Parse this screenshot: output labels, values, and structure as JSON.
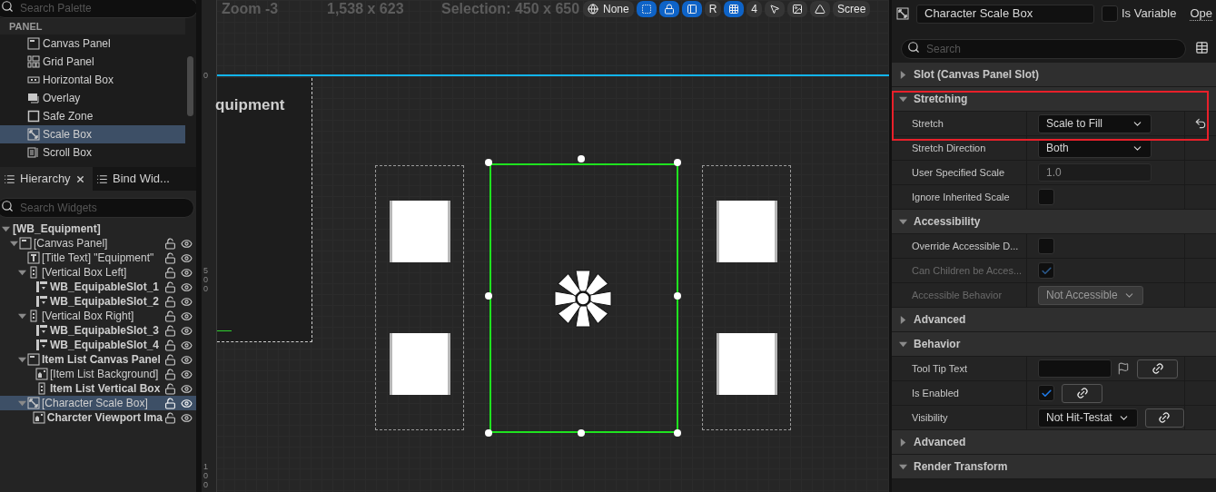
{
  "palette": {
    "search_placeholder": "Search Palette",
    "category": "PANEL",
    "items": [
      {
        "label": "Canvas Panel",
        "kind": "canvas",
        "selected": false
      },
      {
        "label": "Grid Panel",
        "kind": "grid",
        "selected": false
      },
      {
        "label": "Horizontal Box",
        "kind": "hbox",
        "selected": false
      },
      {
        "label": "Overlay",
        "kind": "overlay",
        "selected": false
      },
      {
        "label": "Safe Zone",
        "kind": "safezone",
        "selected": false
      },
      {
        "label": "Scale Box",
        "kind": "scalebox",
        "selected": true
      },
      {
        "label": "Scroll Box",
        "kind": "scrollbox",
        "selected": false
      }
    ]
  },
  "hierarchy": {
    "tabs": [
      {
        "label": "Hierarchy",
        "selected": true,
        "closable": true
      },
      {
        "label": "Bind Wid...",
        "selected": false,
        "closable": false
      }
    ],
    "search_placeholder": "Search Widgets",
    "tree": [
      {
        "label": "[WB_Equipment]",
        "kind": "root",
        "bold": true,
        "selected": false,
        "expanded": true,
        "children": [
          {
            "label": "[Canvas Panel]",
            "kind": "canvas",
            "bold": false,
            "selected": false,
            "expanded": true,
            "children": [
              {
                "label": "[Title Text] \"Equipment\"",
                "kind": "text",
                "bold": false,
                "selected": false
              },
              {
                "label": "[Vertical Box Left]",
                "kind": "vbox",
                "bold": false,
                "selected": false,
                "expanded": true,
                "children": [
                  {
                    "label": "WB_EquipableSlot_1",
                    "kind": "userwidget",
                    "bold": true,
                    "selected": false
                  },
                  {
                    "label": "WB_EquipableSlot_2",
                    "kind": "userwidget",
                    "bold": true,
                    "selected": false
                  }
                ]
              },
              {
                "label": "[Vertical Box Right]",
                "kind": "vbox",
                "bold": false,
                "selected": false,
                "expanded": true,
                "children": [
                  {
                    "label": "WB_EquipableSlot_3",
                    "kind": "userwidget",
                    "bold": true,
                    "selected": false
                  },
                  {
                    "label": "WB_EquipableSlot_4",
                    "kind": "userwidget",
                    "bold": true,
                    "selected": false
                  }
                ]
              },
              {
                "label": "Item List Canvas Panel",
                "kind": "canvas",
                "bold": true,
                "selected": false,
                "expanded": true,
                "children": [
                  {
                    "label": "[Item List Background]",
                    "kind": "image",
                    "bold": false,
                    "selected": false
                  },
                  {
                    "label": "Item List Vertical Box",
                    "kind": "vbox",
                    "bold": true,
                    "selected": false
                  }
                ]
              },
              {
                "label": "[Character Scale Box]",
                "kind": "scalebox",
                "bold": false,
                "selected": true,
                "expanded": true,
                "children": [
                  {
                    "label": "Charcter Viewport Ima",
                    "kind": "image",
                    "bold": true,
                    "selected": false
                  }
                ]
              }
            ]
          }
        ]
      }
    ]
  },
  "canvas": {
    "toolbar": {
      "zoom": "Zoom -3",
      "resolution": "1,538 x 623",
      "selection": "Selection: 450 x 650",
      "buttons": [
        {
          "kind": "globe",
          "label": "None",
          "on": false
        },
        {
          "kind": "outline",
          "on": true
        },
        {
          "kind": "lock",
          "on": true
        },
        {
          "kind": "panel",
          "on": true
        },
        {
          "kind": "text",
          "label": "R",
          "on": false
        },
        {
          "kind": "grid",
          "on": true
        },
        {
          "kind": "text",
          "label": "4",
          "on": false
        },
        {
          "kind": "cursor",
          "on": false
        },
        {
          "kind": "image",
          "on": false
        },
        {
          "kind": "triangle",
          "on": false
        },
        {
          "kind": "text",
          "label": "Scree",
          "on": false
        }
      ]
    },
    "ruler_labels": [
      "0",
      "500",
      "100"
    ],
    "title_text": "quipment"
  },
  "details": {
    "name": "Character Scale Box",
    "is_variable": {
      "label": "Is Variable",
      "checked": false
    },
    "open_link": "Ope",
    "search_placeholder": "Search",
    "rows": [
      {
        "kind": "category",
        "label": "Slot (Canvas Panel Slot)",
        "expanded": false
      },
      {
        "kind": "category",
        "label": "Stretching",
        "expanded": true
      },
      {
        "kind": "dropdown",
        "label": "Stretch",
        "value": "Scale to Fill",
        "disabled": false,
        "modified": true,
        "bindable": false
      },
      {
        "kind": "dropdown",
        "label": "Stretch Direction",
        "value": "Both",
        "disabled": false,
        "modified": false,
        "bindable": false
      },
      {
        "kind": "number",
        "label": "User Specified Scale",
        "value": "1.0",
        "disabled": false,
        "modified": false,
        "bindable": false
      },
      {
        "kind": "checkbox",
        "label": "Ignore Inherited Scale",
        "checked": false,
        "disabled": false,
        "modified": false,
        "bindable": false
      },
      {
        "kind": "category",
        "label": "Accessibility",
        "expanded": true
      },
      {
        "kind": "checkbox",
        "label": "Override Accessible D...",
        "checked": false,
        "disabled": false,
        "modified": false,
        "bindable": false
      },
      {
        "kind": "checkbox",
        "label": "Can Children be Acces...",
        "checked": true,
        "disabled": true,
        "modified": false,
        "bindable": false
      },
      {
        "kind": "dropdown",
        "label": "Accessible Behavior",
        "value": "Not Accessible",
        "disabled": true,
        "modified": false,
        "bindable": false
      },
      {
        "kind": "category",
        "label": "Advanced",
        "expanded": false
      },
      {
        "kind": "category",
        "label": "Behavior",
        "expanded": true
      },
      {
        "kind": "text",
        "label": "Tool Tip Text",
        "disabled": false,
        "modified": false,
        "bindable": true
      },
      {
        "kind": "checkbox",
        "label": "Is Enabled",
        "checked": true,
        "disabled": false,
        "modified": false,
        "bindable": true
      },
      {
        "kind": "dropdown",
        "label": "Visibility",
        "value": "Not Hit-Testat",
        "disabled": false,
        "modified": false,
        "bindable": true
      },
      {
        "kind": "category",
        "label": "Advanced",
        "expanded": false
      },
      {
        "kind": "category",
        "label": "Render Transform",
        "expanded": true
      }
    ]
  }
}
